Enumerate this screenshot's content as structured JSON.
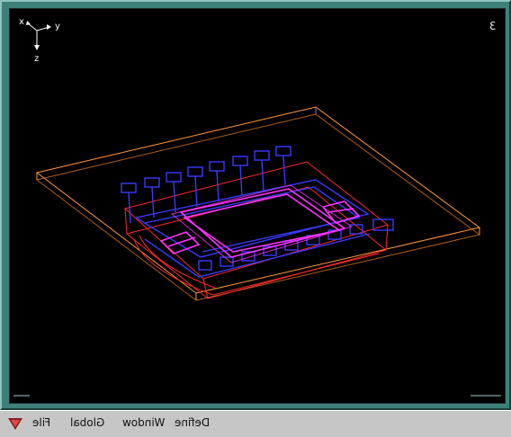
{
  "viewport": {
    "view_number": "3",
    "axes": {
      "x": "x",
      "y": "y",
      "z": "z"
    }
  },
  "menubar": {
    "items": [
      {
        "label": "File"
      },
      {
        "label": "Global"
      },
      {
        "label": "Window"
      },
      {
        "label": "Define"
      }
    ]
  },
  "colors": {
    "background": "#000000",
    "plate": "#ff9a3c",
    "part_outline": "#ff2a2a",
    "components": "#3a3aff",
    "highlight": "#ff33ff",
    "frame": "#3f7f7a",
    "menubar": "#c6c6c6"
  }
}
